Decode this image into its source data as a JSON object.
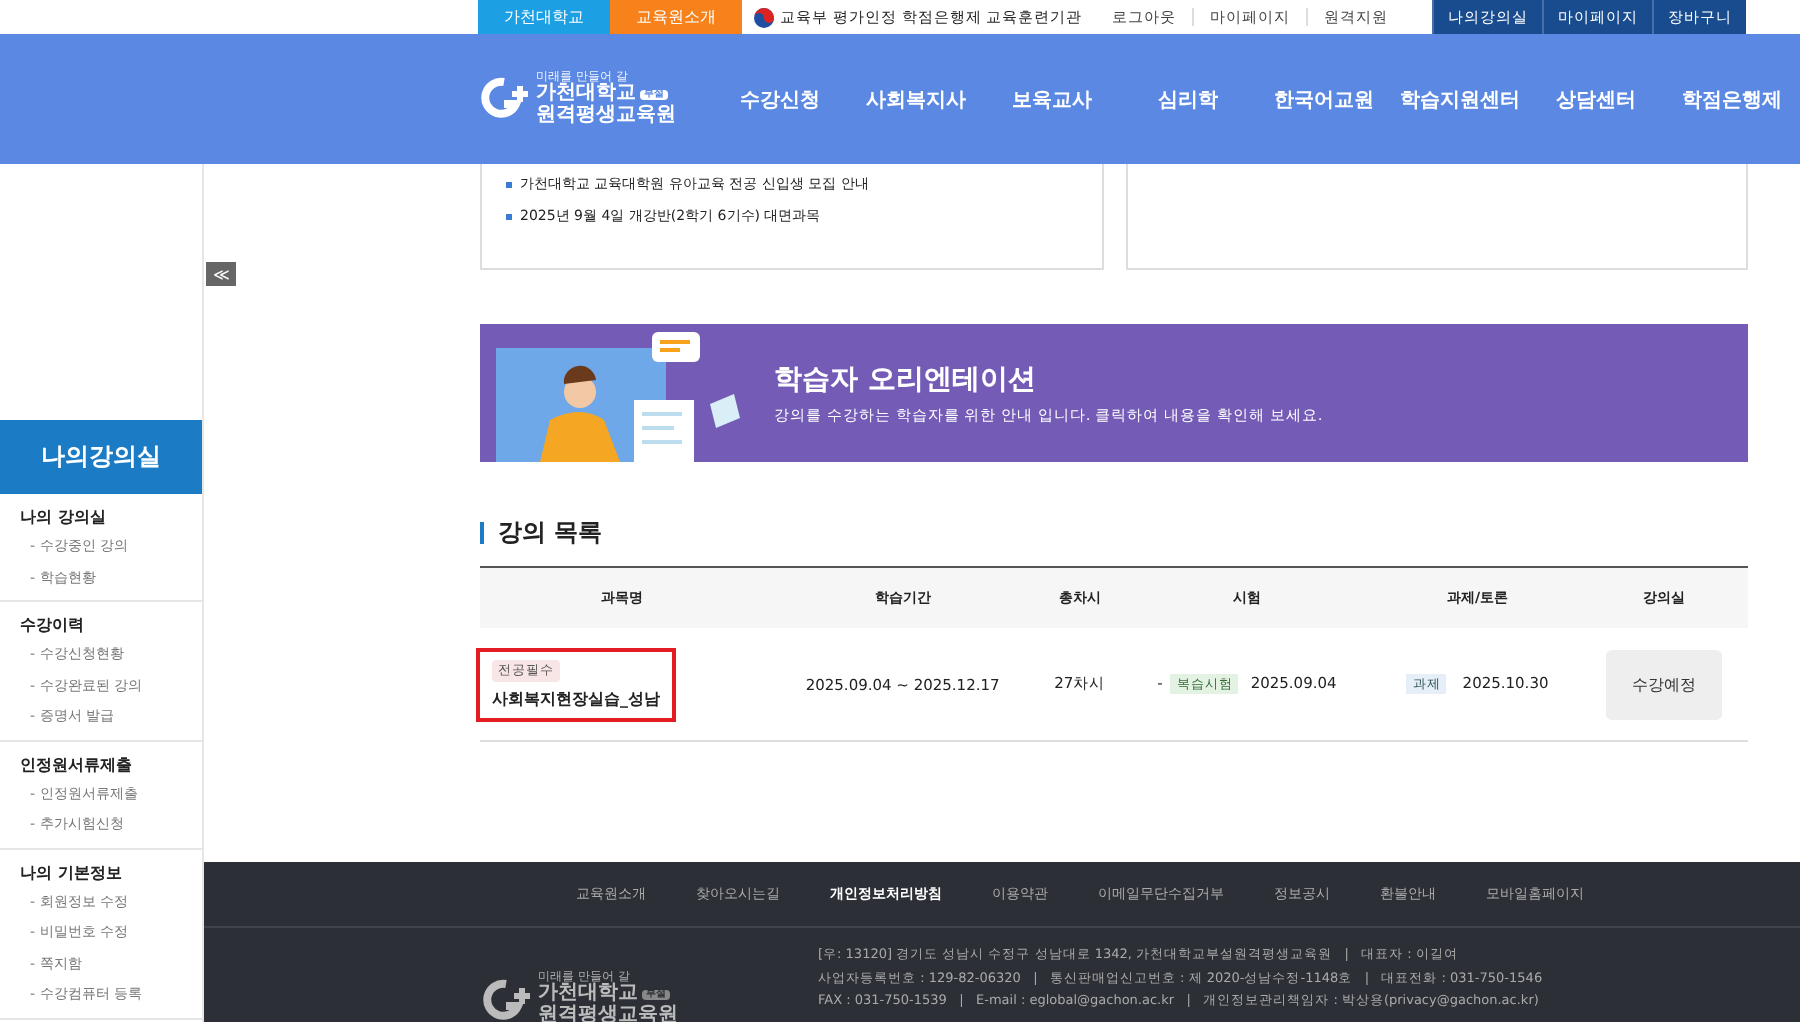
{
  "top_bar": {
    "site_tabs": [
      {
        "label": "가천대학교",
        "color": "#1d9fe3"
      },
      {
        "label": "교육원소개",
        "color": "#f7821b"
      }
    ],
    "accreditation": "교육부 평가인정 학점은행제 교육훈련기관",
    "links": [
      "로그아웃",
      "마이페이지",
      "원격지원"
    ],
    "buttons": [
      "나의강의실",
      "마이페이지",
      "장바구니"
    ]
  },
  "nav": {
    "logo": {
      "tagline": "미래를 만들어 갈",
      "name": "가천대학교",
      "badge": "부설",
      "subname": "원격평생교육원"
    },
    "items": [
      "수강신청",
      "사회복지사",
      "보육교사",
      "심리학",
      "한국어교원",
      "학습지원센터",
      "상담센터",
      "학점은행제"
    ]
  },
  "notice_card": {
    "items": [
      "가천대학교 교육대학원 유아교육 전공 신입생 모집 안내",
      "2025년 9월 4일 개강반(2학기 6기수) 대면과목"
    ]
  },
  "banner": {
    "title": "학습자 오리엔테이션",
    "subtitle": "강의를 수강하는 학습자를 위한 안내 입니다. 클릭하여 내용을 확인해 보세요."
  },
  "sidebar": {
    "title": "나의강의실",
    "collapse": "≪",
    "groups": [
      {
        "heading": "나의 강의실",
        "items": [
          "- 수강중인 강의",
          "- 학습현황"
        ]
      },
      {
        "heading": "수강이력",
        "items": [
          "- 수강신청현황",
          "- 수강완료된 강의",
          "- 증명서 발급"
        ]
      },
      {
        "heading": "인정원서류제출",
        "items": [
          "- 인정원서류제출",
          "- 추가시험신청"
        ]
      },
      {
        "heading": "나의 기본정보",
        "items": [
          "- 회원정보 수정",
          "- 비밀번호 수정",
          "- 쪽지함",
          "- 수강컴퓨터 등록"
        ]
      }
    ]
  },
  "course_list": {
    "title": "강의 목록",
    "columns": [
      "과목명",
      "학습기간",
      "총차시",
      "시험",
      "과제/토론",
      "강의실"
    ],
    "rows": [
      {
        "tag": "전공필수",
        "name": "사회복지현장실습_성남",
        "highlighted": true,
        "period": "2025.09.04 ~ 2025.12.17",
        "sessions": "27차시",
        "exam_dash": "-",
        "exam_tag": "복습시험",
        "exam_date": "2025.09.04",
        "task_tag": "과제",
        "task_date": "2025.10.30",
        "action": "수강예정"
      }
    ]
  },
  "footer": {
    "links": [
      {
        "label": "교육원소개",
        "emphasized": false
      },
      {
        "label": "찾아오시는길",
        "emphasized": false
      },
      {
        "label": "개인정보처리방침",
        "emphasized": true
      },
      {
        "label": "이용약관",
        "emphasized": false
      },
      {
        "label": "이메일무단수집거부",
        "emphasized": false
      },
      {
        "label": "정보공시",
        "emphasized": false
      },
      {
        "label": "환불안내",
        "emphasized": false
      },
      {
        "label": "모바일홈페이지",
        "emphasized": false
      }
    ],
    "logo": {
      "tagline": "미래를 만들어 갈",
      "name": "가천대학교",
      "badge": "부설",
      "subname": "원격평생교육원"
    },
    "info": [
      "[우: 13120] 경기도 성남시 수정구 성남대로 1342, 가천대학교부설원격평생교육원   |   대표자 : 이길여",
      "사업자등록번호 : 129-82-06320   |   통신판매업신고번호 : 제 2020-성남수정-1148호   |   대표전화 : 031-750-1546",
      "FAX : 031-750-1539   |   E-mail : eglobal@gachon.ac.kr   |   개인정보관리책임자 : 박상용(privacy@gachon.ac.kr)"
    ]
  }
}
